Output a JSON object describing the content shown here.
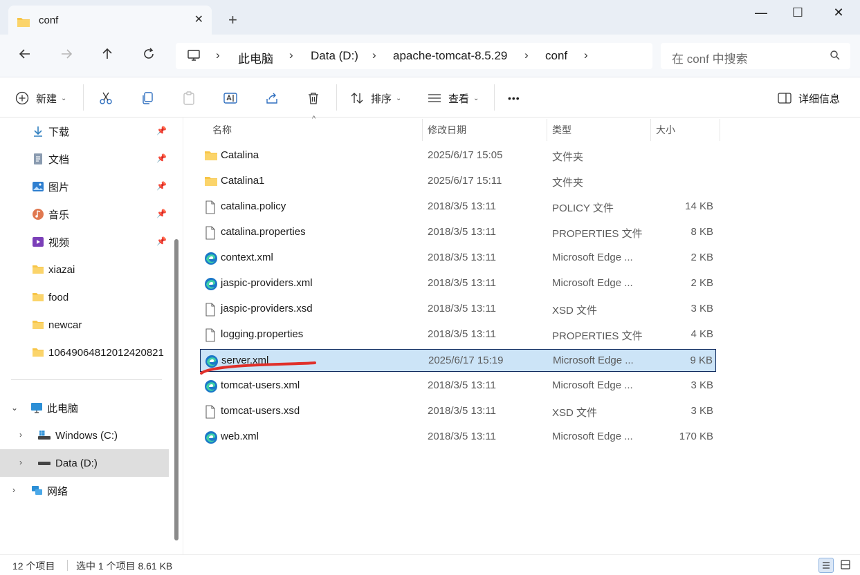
{
  "window": {
    "tab_label": "conf",
    "tab_close": "✕",
    "new_tab": "+",
    "minimize": "—",
    "maximize": "☐",
    "close": "✕"
  },
  "address": {
    "crumbs": [
      "此电脑",
      "Data (D:)",
      "apache-tomcat-8.5.29",
      "conf"
    ],
    "separator": "›",
    "search_placeholder": "在 conf 中搜索"
  },
  "toolbar": {
    "new_label": "新建",
    "sort_label": "排序",
    "view_label": "查看",
    "more_label": "•••",
    "details_label": "详细信息"
  },
  "sidebar": {
    "quick_access": [
      {
        "label": "下载",
        "icon": "download-icon",
        "pinned": true
      },
      {
        "label": "文档",
        "icon": "document-icon",
        "pinned": true
      },
      {
        "label": "图片",
        "icon": "pictures-icon",
        "pinned": true
      },
      {
        "label": "音乐",
        "icon": "music-icon",
        "pinned": true
      },
      {
        "label": "视频",
        "icon": "video-icon",
        "pinned": true
      },
      {
        "label": "xiazai",
        "icon": "folder-icon",
        "pinned": false
      },
      {
        "label": "food",
        "icon": "folder-icon",
        "pinned": false
      },
      {
        "label": "newcar",
        "icon": "folder-icon",
        "pinned": false
      },
      {
        "label": "10649064812012420821",
        "icon": "folder-icon",
        "pinned": false
      }
    ],
    "this_pc": "此电脑",
    "drive_c": "Windows (C:)",
    "drive_d": "Data (D:)",
    "network": "网络"
  },
  "columns": {
    "name": "名称",
    "date": "修改日期",
    "type": "类型",
    "size": "大小"
  },
  "files": [
    {
      "name": "Catalina",
      "date": "2025/6/17 15:05",
      "type": "文件夹",
      "size": "",
      "icon": "folder-icon"
    },
    {
      "name": "Catalina1",
      "date": "2025/6/17 15:11",
      "type": "文件夹",
      "size": "",
      "icon": "folder-icon"
    },
    {
      "name": "catalina.policy",
      "date": "2018/3/5 13:11",
      "type": "POLICY 文件",
      "size": "14 KB",
      "icon": "file-icon"
    },
    {
      "name": "catalina.properties",
      "date": "2018/3/5 13:11",
      "type": "PROPERTIES 文件",
      "size": "8 KB",
      "icon": "file-icon"
    },
    {
      "name": "context.xml",
      "date": "2018/3/5 13:11",
      "type": "Microsoft Edge ...",
      "size": "2 KB",
      "icon": "edge-icon"
    },
    {
      "name": "jaspic-providers.xml",
      "date": "2018/3/5 13:11",
      "type": "Microsoft Edge ...",
      "size": "2 KB",
      "icon": "edge-icon"
    },
    {
      "name": "jaspic-providers.xsd",
      "date": "2018/3/5 13:11",
      "type": "XSD 文件",
      "size": "3 KB",
      "icon": "file-icon"
    },
    {
      "name": "logging.properties",
      "date": "2018/3/5 13:11",
      "type": "PROPERTIES 文件",
      "size": "4 KB",
      "icon": "file-icon"
    },
    {
      "name": "server.xml",
      "date": "2025/6/17 15:19",
      "type": "Microsoft Edge ...",
      "size": "9 KB",
      "icon": "edge-icon",
      "selected": true
    },
    {
      "name": "tomcat-users.xml",
      "date": "2018/3/5 13:11",
      "type": "Microsoft Edge ...",
      "size": "3 KB",
      "icon": "edge-icon"
    },
    {
      "name": "tomcat-users.xsd",
      "date": "2018/3/5 13:11",
      "type": "XSD 文件",
      "size": "3 KB",
      "icon": "file-icon"
    },
    {
      "name": "web.xml",
      "date": "2018/3/5 13:11",
      "type": "Microsoft Edge ...",
      "size": "170 KB",
      "icon": "edge-icon"
    }
  ],
  "status": {
    "count": "12 个项目",
    "selection": "选中 1 个项目  8.61 KB"
  },
  "colors": {
    "selection_bg": "#cce4f7",
    "folder": "#f7c548",
    "annotation_red": "#e0302a"
  }
}
